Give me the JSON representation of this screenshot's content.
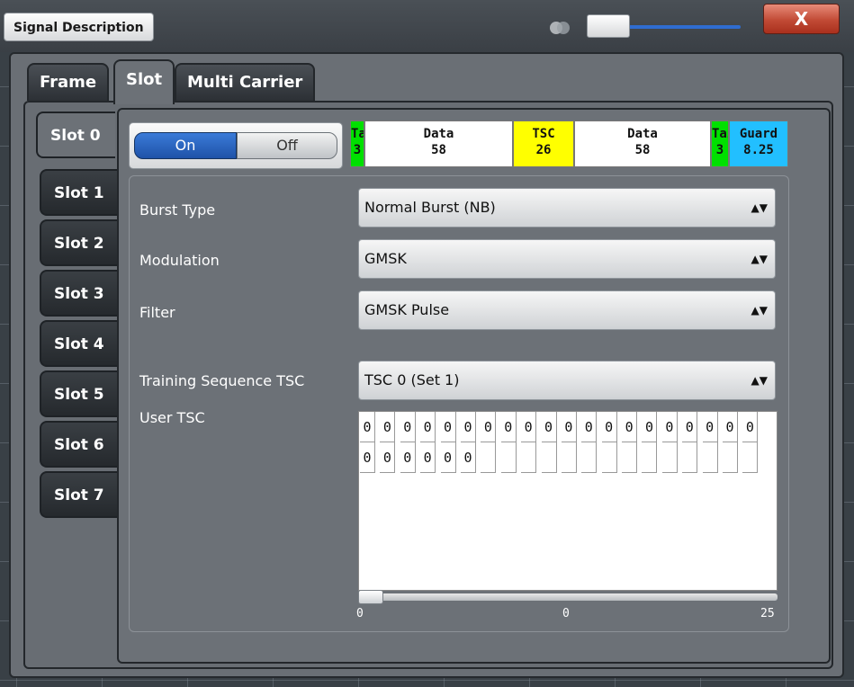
{
  "window": {
    "title": "Signal Description",
    "close_label": "X"
  },
  "main_tabs": [
    {
      "label": "Frame",
      "active": false
    },
    {
      "label": "Slot",
      "active": true
    },
    {
      "label": "Multi Carrier",
      "active": false
    }
  ],
  "slot_tabs": [
    {
      "label": "Slot 0",
      "active": true
    },
    {
      "label": "Slot 1",
      "active": false
    },
    {
      "label": "Slot 2",
      "active": false
    },
    {
      "label": "Slot 3",
      "active": false
    },
    {
      "label": "Slot 4",
      "active": false
    },
    {
      "label": "Slot 5",
      "active": false
    },
    {
      "label": "Slot 6",
      "active": false
    },
    {
      "label": "Slot 7",
      "active": false
    }
  ],
  "toggle": {
    "on_label": "On",
    "off_label": "Off",
    "state": "On"
  },
  "burst": [
    {
      "label": "Tail",
      "value": "3",
      "color": "#00e000"
    },
    {
      "label": "Data",
      "value": "58",
      "color": "#ffffff"
    },
    {
      "label": "TSC",
      "value": "26",
      "color": "#ffff00"
    },
    {
      "label": "Data",
      "value": "58",
      "color": "#ffffff"
    },
    {
      "label": "Tail",
      "value": "3",
      "color": "#00e000"
    },
    {
      "label": "Guard",
      "value": "8.25",
      "color": "#22bfff"
    }
  ],
  "settings": {
    "burst_type": {
      "label": "Burst Type",
      "value": "Normal Burst (NB)"
    },
    "modulation": {
      "label": "Modulation",
      "value": "GMSK"
    },
    "filter": {
      "label": "Filter",
      "value": "GMSK Pulse"
    },
    "tsc": {
      "label": "Training Sequence TSC",
      "value": "TSC 0 (Set 1)"
    },
    "user_tsc_label": "User TSC"
  },
  "user_tsc": {
    "row1": [
      "0",
      "0",
      "0",
      "0",
      "0",
      "0",
      "0",
      "0",
      "0",
      "0",
      "0",
      "0",
      "0",
      "0",
      "0",
      "0",
      "0",
      "0",
      "0",
      "0"
    ],
    "row2": [
      "0",
      "0",
      "0",
      "0",
      "0",
      "0",
      "",
      "",
      "",
      "",
      "",
      "",
      "",
      "",
      "",
      "",
      "",
      "",
      "",
      ""
    ]
  },
  "scroll": {
    "left": "0",
    "center": "0",
    "right": "25"
  },
  "colors": {
    "accent_blue": "#1f52a8",
    "close_red": "#c14a35",
    "tail_green": "#00e000",
    "tsc_yellow": "#ffff00",
    "guard_cyan": "#22bfff"
  }
}
